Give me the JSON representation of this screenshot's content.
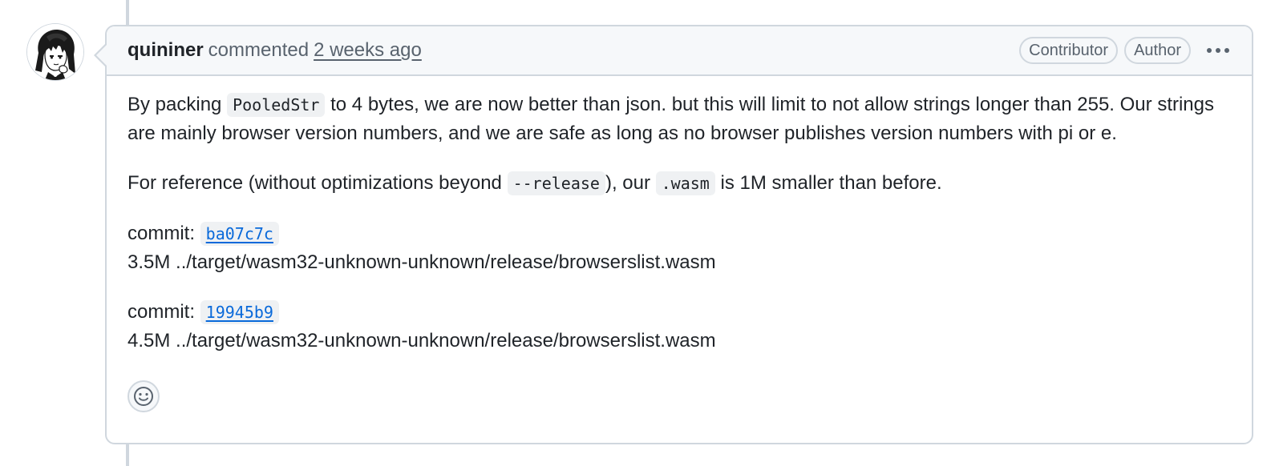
{
  "comment": {
    "author": "quininer",
    "action": "commented",
    "timestamp": "2 weeks ago",
    "badges": [
      "Contributor",
      "Author"
    ],
    "paragraph1": {
      "before": "By packing ",
      "code": "PooledStr",
      "after": " to 4 bytes, we are now better than json. but this will limit to not allow strings longer than 255. Our strings are mainly browser version numbers, and we are safe as long as no browser publishes version numbers with pi or e."
    },
    "paragraph2": {
      "before": "For reference (without optimizations beyond ",
      "code1": "--release",
      "middle": "), our ",
      "code2": ".wasm",
      "after": " is 1M smaller than before."
    },
    "commits": [
      {
        "label": "commit: ",
        "hash": "ba07c7c",
        "size_line": "3.5M ../target/wasm32-unknown-unknown/release/browserslist.wasm"
      },
      {
        "label": "commit: ",
        "hash": "19945b9",
        "size_line": "4.5M ../target/wasm32-unknown-unknown/release/browserslist.wasm"
      }
    ]
  },
  "icons": {
    "more": "kebab-horizontal-icon",
    "reaction": "smiley-icon"
  },
  "colors": {
    "link": "#0969da",
    "border": "#d0d7de",
    "header_bg": "#f6f8fa"
  }
}
